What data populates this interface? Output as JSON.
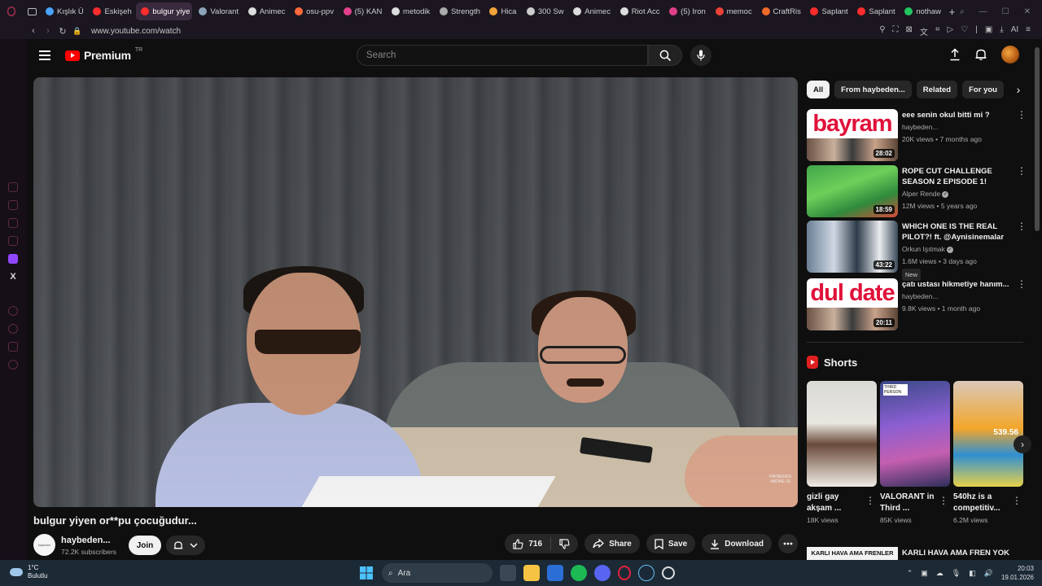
{
  "browser": {
    "tabs": [
      {
        "label": "Kışlık Ü",
        "color": "#4aa3ff"
      },
      {
        "label": "Eskişeh",
        "color": "#ff2d2d"
      },
      {
        "label": "bulgur yiye",
        "color": "#ff2d2d",
        "active": true
      },
      {
        "label": "Valorant",
        "color": "#8aa3b8"
      },
      {
        "label": "Animec",
        "color": "#dddddd"
      },
      {
        "label": "osu-ppv",
        "color": "#ff6a3d"
      },
      {
        "label": "(5) KAN",
        "color": "#e0408a"
      },
      {
        "label": "metodik",
        "color": "#dddddd"
      },
      {
        "label": "Strength",
        "color": "#aaaaaa"
      },
      {
        "label": "Hica",
        "color": "#f2a33a"
      },
      {
        "label": "300 Sw",
        "color": "#cccccc"
      },
      {
        "label": "Animec",
        "color": "#dddddd"
      },
      {
        "label": "Riot Acc",
        "color": "#dddddd"
      },
      {
        "label": "(5) Iron",
        "color": "#e0408a"
      },
      {
        "label": "memoc",
        "color": "#ea4335"
      },
      {
        "label": "CraftRis",
        "color": "#f06a2a"
      },
      {
        "label": "Saplant",
        "color": "#ff2d2d"
      },
      {
        "label": "Saplant",
        "color": "#ff2d2d"
      },
      {
        "label": "nothaw",
        "color": "#22c55e"
      }
    ],
    "url": "www.youtube.com/watch",
    "ai_label": "AI"
  },
  "header": {
    "logo_text": "Premium",
    "logo_country": "TR",
    "search_placeholder": "Search"
  },
  "video": {
    "title": "bulgur yiyen or**pu çocuğudur...",
    "watermark_line1": "HAYBEDEN",
    "watermark_line2": "ABONE OL",
    "channel_name": "haybeden...",
    "subscribers": "72.2K subscribers",
    "channel_avatar_text": "haybeden",
    "join_label": "Join",
    "like_count": "716",
    "share_label": "Share",
    "save_label": "Save",
    "download_label": "Download"
  },
  "chips": [
    "All",
    "From haybeden...",
    "Related",
    "For you"
  ],
  "recommendations": [
    {
      "title": "eee senin okul bitti mi ?",
      "channel": "haybeden...",
      "meta": "20K views • 7 months ago",
      "duration": "28:02",
      "thumb_text": "bayram",
      "verified": false,
      "badge": ""
    },
    {
      "title": "ROPE CUT CHALLENGE SEASON 2 EPISODE 1!",
      "channel": "Alper Rende",
      "meta": "12M views • 5 years ago",
      "duration": "18:59",
      "thumb_text": "",
      "verified": true,
      "badge": ""
    },
    {
      "title": "WHICH ONE IS THE REAL PILOT?! ft. @Aynisinemalar",
      "channel": "Orkun Işıtmak",
      "meta": "1.6M views • 3 days ago",
      "duration": "43:22",
      "thumb_text": "",
      "verified": true,
      "badge": "New"
    },
    {
      "title": "çatı ustası hikmetiye hanım...",
      "channel": "haybeden...",
      "meta": "9.8K views • 1 month ago",
      "duration": "20:11",
      "thumb_text": "dul date",
      "verified": false,
      "badge": ""
    }
  ],
  "shorts": {
    "heading": "Shorts",
    "items": [
      {
        "title": "gizli gay akşam ...",
        "views": "18K views",
        "thumb_text": ""
      },
      {
        "title": "VALORANT in Third ...",
        "views": "85K views",
        "thumb_text": "THIRD PERSON"
      },
      {
        "title": "540hz is a competitiv...",
        "views": "6.2M views",
        "thumb_text": "539.56"
      }
    ]
  },
  "bottom_rec": {
    "thumb_text": "KARLI HAVA AMA FRENLER",
    "title": "KARLI HAVA AMA FREN YOK"
  },
  "taskbar": {
    "temperature": "1°C",
    "condition": "Bulutlu",
    "search_label": "Ara",
    "time": "20:03",
    "date": "19.01.2026"
  }
}
